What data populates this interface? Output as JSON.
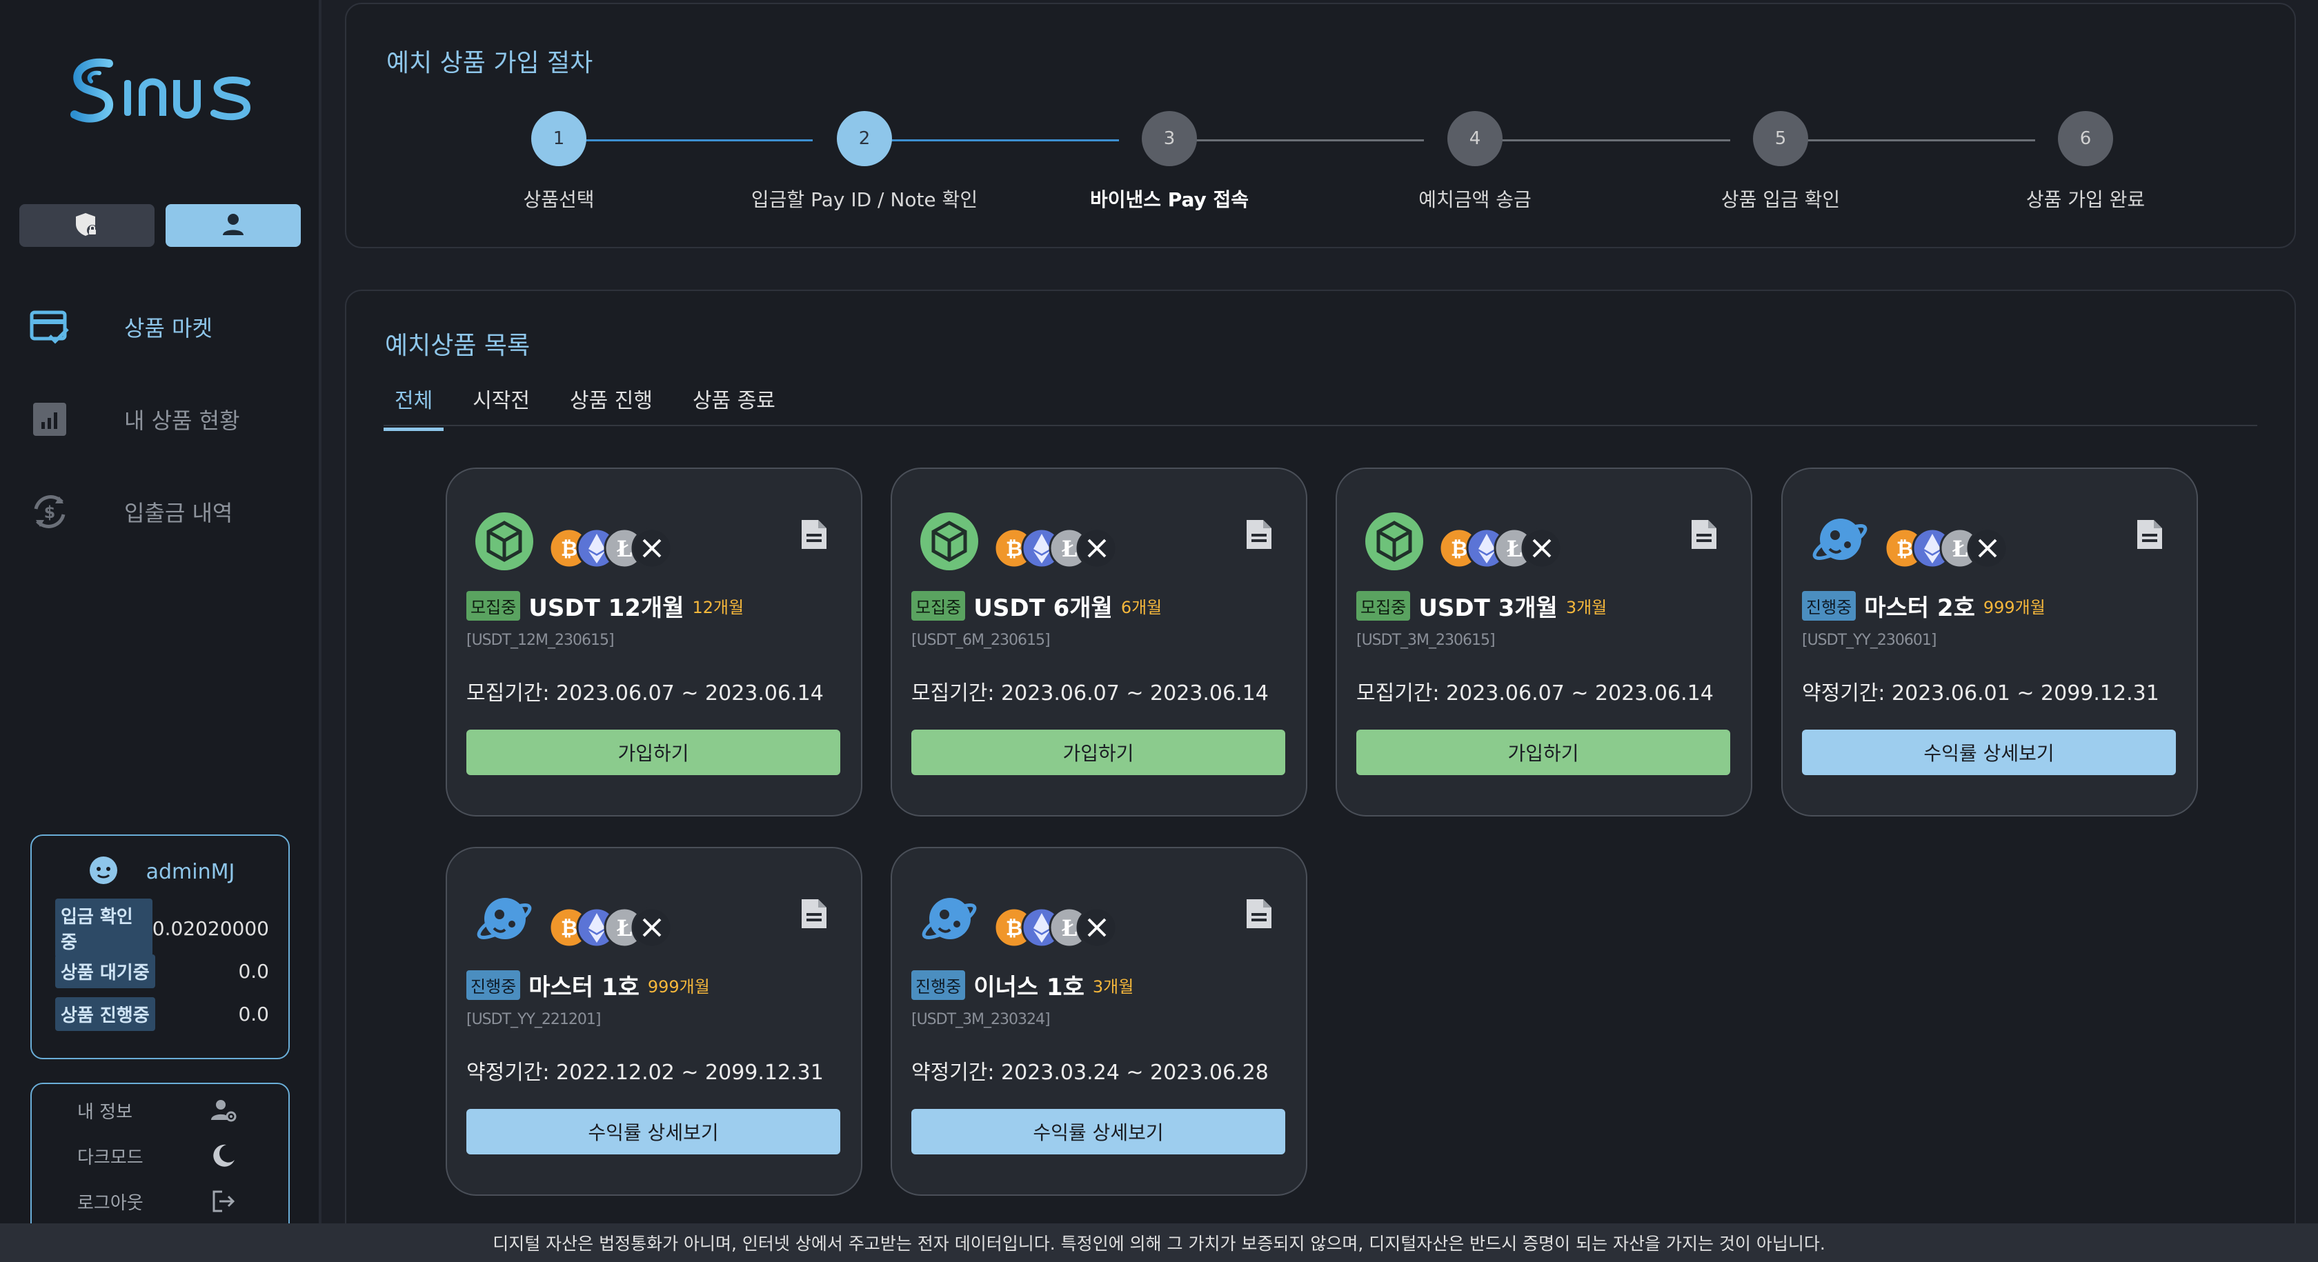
{
  "brand": {
    "logo_text": "Sinus",
    "accent": "#8ec6ea"
  },
  "sidebar": {
    "toggles": [
      {
        "icon": "shield-lock-icon"
      },
      {
        "icon": "user-icon",
        "active": true
      }
    ],
    "nav": [
      {
        "label": "상품 마켓",
        "icon": "card-check-icon",
        "active": true
      },
      {
        "label": "내 상품 현황",
        "icon": "bar-chart-icon"
      },
      {
        "label": "입출금 내역",
        "icon": "dollar-exchange-icon"
      }
    ],
    "user": {
      "username": "adminMJ",
      "stats": [
        {
          "label": "입금 확인중",
          "value": "0.02020000"
        },
        {
          "label": "상품 대기중",
          "value": "0.0"
        },
        {
          "label": "상품 진행중",
          "value": "0.0"
        }
      ]
    },
    "menu": [
      {
        "label": "내 정보",
        "icon": "user-settings-icon"
      },
      {
        "label": "다크모드",
        "icon": "moon-icon"
      },
      {
        "label": "로그아웃",
        "icon": "logout-icon"
      }
    ]
  },
  "steps_panel": {
    "title": "예치 상품 가입 절차",
    "steps": [
      {
        "num": "1",
        "label": "상품선택",
        "state": "done"
      },
      {
        "num": "2",
        "label": "입금할 Pay ID / Note 확인",
        "state": "done"
      },
      {
        "num": "3",
        "label": "바이낸스 Pay 접속",
        "state": "current"
      },
      {
        "num": "4",
        "label": "예치금액 송금",
        "state": "todo"
      },
      {
        "num": "5",
        "label": "상품 입금 확인",
        "state": "todo"
      },
      {
        "num": "6",
        "label": "상품 가입 완료",
        "state": "todo"
      }
    ]
  },
  "list_panel": {
    "title": "예치상품 목록",
    "tabs": [
      "전체",
      "시작전",
      "상품 진행",
      "상품 종료"
    ],
    "active_tab": "전체",
    "cards": [
      {
        "logo": "cube-logo",
        "badge": "모집중",
        "badge_type": "recruit",
        "name": "USDT 12개월",
        "period": "12개월",
        "code": "[USDT_12M_230615]",
        "dates": "모집기간: 2023.06.07 ~ 2023.06.14",
        "button": "가입하기",
        "button_type": "join"
      },
      {
        "logo": "cube-logo",
        "badge": "모집중",
        "badge_type": "recruit",
        "name": "USDT 6개월",
        "period": "6개월",
        "code": "[USDT_6M_230615]",
        "dates": "모집기간: 2023.06.07 ~ 2023.06.14",
        "button": "가입하기",
        "button_type": "join"
      },
      {
        "logo": "cube-logo",
        "badge": "모집중",
        "badge_type": "recruit",
        "name": "USDT 3개월",
        "period": "3개월",
        "code": "[USDT_3M_230615]",
        "dates": "모집기간: 2023.06.07 ~ 2023.06.14",
        "button": "가입하기",
        "button_type": "join"
      },
      {
        "logo": "planet-logo",
        "badge": "진행중",
        "badge_type": "prog",
        "name": "마스터 2호",
        "period": "999개월",
        "code": "[USDT_YY_230601]",
        "dates": "약정기간: 2023.06.01 ~ 2099.12.31",
        "button": "수익률 상세보기",
        "button_type": "detail"
      },
      {
        "logo": "planet-logo",
        "badge": "진행중",
        "badge_type": "prog",
        "name": "마스터 1호",
        "period": "999개월",
        "code": "[USDT_YY_221201]",
        "dates": "약정기간: 2022.12.02 ~ 2099.12.31",
        "button": "수익률 상세보기",
        "button_type": "detail"
      },
      {
        "logo": "planet-logo",
        "badge": "진행중",
        "badge_type": "prog",
        "name": "이너스 1호",
        "period": "3개월",
        "code": "[USDT_3M_230324]",
        "dates": "약정기간: 2023.03.24 ~ 2023.06.28",
        "button": "수익률 상세보기",
        "button_type": "detail"
      }
    ],
    "coin_icons": [
      "bitcoin-icon",
      "ethereum-icon",
      "litecoin-icon",
      "xrp-icon"
    ]
  },
  "footer": {
    "notice": "디지털 자산은 법정통화가 아니며, 인터넷 상에서 주고받는 전자 데이터입니다. 특정인에 의해 그 가치가 보증되지 않으며, 디지털자산은 반드시 증명이 되는 자산을 가지는 것이 아닙니다."
  }
}
